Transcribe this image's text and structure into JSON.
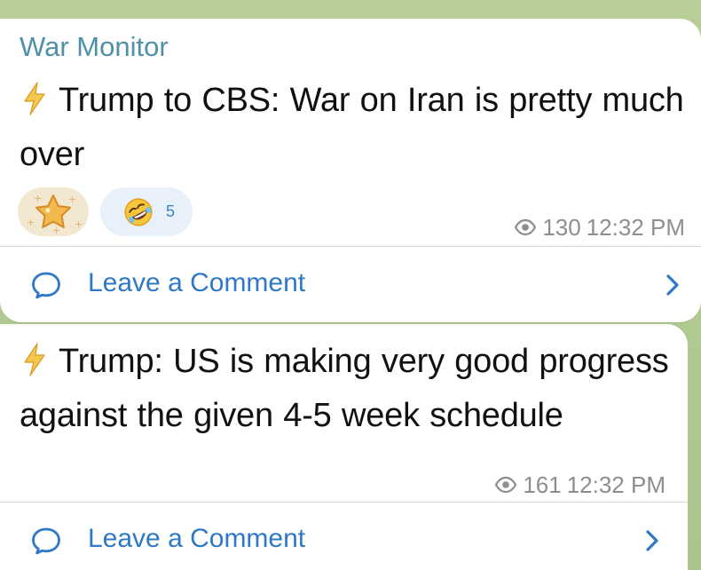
{
  "posts": [
    {
      "channel_name": "War Monitor",
      "message": "Trump to CBS: War on Iran is pretty much over",
      "reactions": [
        {
          "emoji": "⭐",
          "icon": "star-icon"
        },
        {
          "emoji": "🤣",
          "count": "5",
          "icon": "laughing-face-icon"
        }
      ],
      "views": "130",
      "time": "12:32 PM",
      "comment_label": "Leave a Comment"
    },
    {
      "message": "Trump: US is making very good progress against the given 4-5 week schedule",
      "views": "161",
      "time": "12:32 PM",
      "comment_label": "Leave a Comment"
    }
  ],
  "icons": {
    "message_prefix": "lightning-bolt-icon",
    "views": "eye-icon",
    "comment": "comment-bubble-icon",
    "open": "chevron-right-icon"
  },
  "colors": {
    "channel_name": "#4f8fa8",
    "link": "#2f78c5",
    "meta": "#8d8d92",
    "background": "#a9c58c",
    "reaction_blue": "#e8f1fa",
    "reaction_gold": "#f1e4cc"
  }
}
